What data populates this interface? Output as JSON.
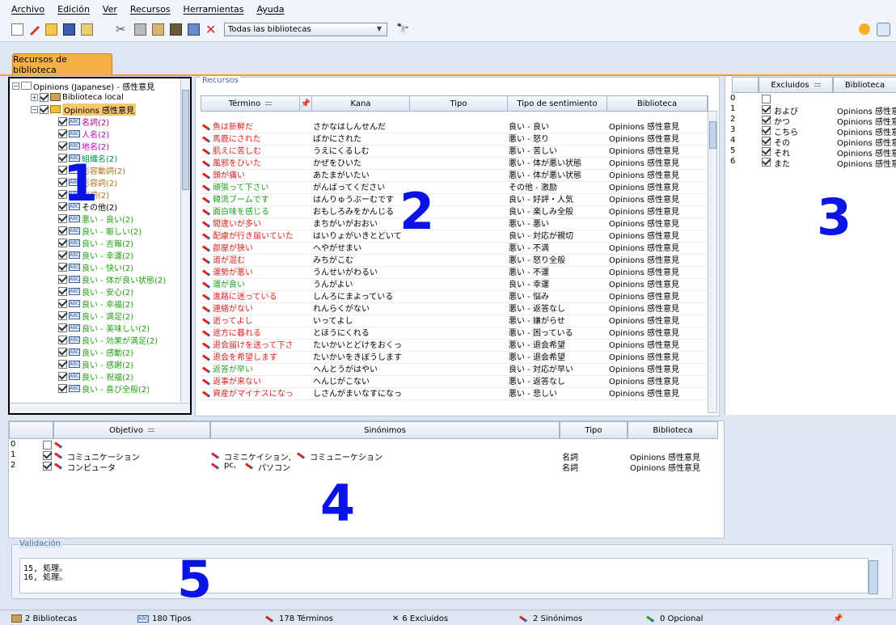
{
  "menu": {
    "items": [
      "Archivo",
      "Edición",
      "Ver",
      "Recursos",
      "Herramientas",
      "Ayuda"
    ]
  },
  "toolbar": {
    "library_selector": "Todas las bibliotecas"
  },
  "tab": {
    "label": "Recursos de biblioteca"
  },
  "tree": {
    "root": "Opinions (Japanese) - 感性意見",
    "local": "Biblioteca local",
    "opinions": "Opinions 感性意見",
    "types": [
      {
        "label": "名詞(2)",
        "color": "#c00090"
      },
      {
        "label": "人名(2)",
        "color": "#c000c0"
      },
      {
        "label": "地名(2)",
        "color": "#c000c0"
      },
      {
        "label": "組織名(2)",
        "color": "#009050"
      },
      {
        "label": "形容動詞(2)",
        "color": "#b07020"
      },
      {
        "label": "形容詞(2)",
        "color": "#b07020"
      },
      {
        "label": "副詞(2)",
        "color": "#b07020"
      },
      {
        "label": "その他(2)",
        "color": "#000000"
      },
      {
        "label": "悪い - 良い(2)",
        "color": "#20a010"
      },
      {
        "label": "良い - 賑しい(2)",
        "color": "#20a010"
      },
      {
        "label": "良い - 吉報(2)",
        "color": "#20a010"
      },
      {
        "label": "良い - 幸運(2)",
        "color": "#20a010"
      },
      {
        "label": "良い - 快い(2)",
        "color": "#20a010"
      },
      {
        "label": "良い - 体が良い状態(2)",
        "color": "#20a010"
      },
      {
        "label": "良い - 安心(2)",
        "color": "#20a010"
      },
      {
        "label": "良い - 幸福(2)",
        "color": "#20a010"
      },
      {
        "label": "良い - 満足(2)",
        "color": "#20a010"
      },
      {
        "label": "良い - 美味しい(2)",
        "color": "#20a010"
      },
      {
        "label": "良い - 効果が満足(2)",
        "color": "#20a010"
      },
      {
        "label": "良い - 感動(2)",
        "color": "#20a010"
      },
      {
        "label": "良い - 感謝(2)",
        "color": "#20a010"
      },
      {
        "label": "良い - 祝福(2)",
        "color": "#20a010"
      },
      {
        "label": "良い - 喜び全般(2)",
        "color": "#20a010"
      }
    ]
  },
  "recursos": {
    "legend": "Recursos",
    "columns": [
      "Término",
      "Kana",
      "Tipo",
      "Tipo de sentimiento",
      "Biblioteca"
    ],
    "rows": [
      {
        "term": "魚は新鮮だ",
        "kana": "さかなはしんせんだ",
        "sent": "良い - 良い",
        "lib": "Opinions 感性意見",
        "color": "#e02020"
      },
      {
        "term": "馬鹿にされた",
        "kana": "ばかにされた",
        "sent": "悪い - 怒り",
        "lib": "Opinions 感性意見",
        "color": "#e02020"
      },
      {
        "term": "肌えに苦しむ",
        "kana": "うえにくるしむ",
        "sent": "悪い - 苦しい",
        "lib": "Opinions 感性意見",
        "color": "#e02020"
      },
      {
        "term": "風邪をひいた",
        "kana": "かぜをひいた",
        "sent": "悪い - 体が悪い状態",
        "lib": "Opinions 感性意見",
        "color": "#e02020"
      },
      {
        "term": "頭が痛い",
        "kana": "あたまがいたい",
        "sent": "悪い - 体が悪い状態",
        "lib": "Opinions 感性意見",
        "color": "#e02020"
      },
      {
        "term": "頑張って下さい",
        "kana": "がんばってください",
        "sent": "その他 - 激励",
        "lib": "Opinions 感性意見",
        "color": "#20a020"
      },
      {
        "term": "韓流ブームです",
        "kana": "はんりゅうぶーむです",
        "sent": "良い - 好評・人気",
        "lib": "Opinions 感性意見",
        "color": "#20a020"
      },
      {
        "term": "面白味を感じる",
        "kana": "おもしろみをかんじる",
        "sent": "良い - 楽しみ全般",
        "lib": "Opinions 感性意見",
        "color": "#20a020"
      },
      {
        "term": "間違いが多い",
        "kana": "まちがいがおおい",
        "sent": "悪い - 悪い",
        "lib": "Opinions 感性意見",
        "color": "#e02020"
      },
      {
        "term": "配慮が行き届いていた",
        "kana": "はいりょがいきとどいて",
        "sent": "良い - 対応が親切",
        "lib": "Opinions 感性意見",
        "color": "#e02020"
      },
      {
        "term": "部屋が狭い",
        "kana": "へやがせまい",
        "sent": "悪い - 不満",
        "lib": "Opinions 感性意見",
        "color": "#e02020"
      },
      {
        "term": "道が混む",
        "kana": "みちがこむ",
        "sent": "悪い - 怒り全般",
        "lib": "Opinions 感性意見",
        "color": "#e02020"
      },
      {
        "term": "運勢が悪い",
        "kana": "うんせいがわるい",
        "sent": "悪い - 不運",
        "lib": "Opinions 感性意見",
        "color": "#e02020"
      },
      {
        "term": "運が良い",
        "kana": "うんがよい",
        "sent": "良い - 幸運",
        "lib": "Opinions 感性意見",
        "color": "#20a020"
      },
      {
        "term": "進路に迷っている",
        "kana": "しんろにまよっている",
        "sent": "悪い - 悩み",
        "lib": "Opinions 感性意見",
        "color": "#e02020"
      },
      {
        "term": "連絡がない",
        "kana": "れんらくがない",
        "sent": "悪い - 返答なし",
        "lib": "Opinions 感性意見",
        "color": "#e02020"
      },
      {
        "term": "逝ってよし",
        "kana": "いってよし",
        "sent": "悪い - 嫌がらせ",
        "lib": "Opinions 感性意見",
        "color": "#e02020"
      },
      {
        "term": "途方に暮れる",
        "kana": "とほうにくれる",
        "sent": "悪い - 困っている",
        "lib": "Opinions 感性意見",
        "color": "#e02020"
      },
      {
        "term": "退会届けを送って下さ",
        "kana": "たいかいとどけをおくっ",
        "sent": "悪い - 退会希望",
        "lib": "Opinions 感性意見",
        "color": "#e02020"
      },
      {
        "term": "退会を希望します",
        "kana": "たいかいをきぼうします",
        "sent": "悪い - 退会希望",
        "lib": "Opinions 感性意見",
        "color": "#e02020"
      },
      {
        "term": "返答が早い",
        "kana": "へんとうがはやい",
        "sent": "良い - 対応が早い",
        "lib": "Opinions 感性意見",
        "color": "#20a020"
      },
      {
        "term": "返事が来ない",
        "kana": "へんじがこない",
        "sent": "悪い - 返答なし",
        "lib": "Opinions 感性意見",
        "color": "#e02020"
      },
      {
        "term": "資産がマイナスになっ",
        "kana": "しさんがまいなすになっ",
        "sent": "悪い - 悲しい",
        "lib": "Opinions 感性意見",
        "color": "#e02020"
      }
    ]
  },
  "excluidos": {
    "columns": [
      "Excluidos",
      "Biblioteca"
    ],
    "rows": [
      {
        "idx": "0",
        "word": "",
        "lib": "",
        "checked": false
      },
      {
        "idx": "1",
        "word": "および",
        "lib": "Opinions 感性意",
        "checked": true
      },
      {
        "idx": "2",
        "word": "かつ",
        "lib": "Opinions 感性意",
        "checked": true
      },
      {
        "idx": "3",
        "word": "こちら",
        "lib": "Opinions 感性意",
        "checked": true
      },
      {
        "idx": "4",
        "word": "その",
        "lib": "Opinions 感性意",
        "checked": true
      },
      {
        "idx": "5",
        "word": "それ",
        "lib": "Opinions 感性意",
        "checked": true
      },
      {
        "idx": "6",
        "word": "また",
        "lib": "Opinions 感性意",
        "checked": true
      }
    ]
  },
  "sinonimos": {
    "columns": [
      "Objetivo",
      "Sinónimos",
      "Tipo",
      "Biblioteca"
    ],
    "rows": [
      {
        "idx": "0",
        "target": "",
        "syn1": "",
        "syn2": "",
        "type": "",
        "lib": "",
        "checked": false
      },
      {
        "idx": "1",
        "target": "コミュニケーション",
        "syn1": "コミニケイション,",
        "syn2": "コミュニーケション",
        "type": "名詞",
        "lib": "Opinions 感性意見",
        "checked": true
      },
      {
        "idx": "2",
        "target": "コンピュータ",
        "syn1": "pc,",
        "syn2": "パソコン",
        "type": "名詞",
        "lib": "Opinions 感性意見",
        "checked": true
      }
    ]
  },
  "validacion": {
    "legend": "Validación",
    "text": "15, 処理。\n16, 処理。"
  },
  "status": [
    "2 Bibliotecas",
    "180 Tipos",
    "178 Términos",
    "6 Excluidos",
    "2 Sinónimos",
    "0 Opcional"
  ],
  "labels": {
    "n1": "1",
    "n2": "2",
    "n3": "3",
    "n4": "4",
    "n5": "5"
  }
}
